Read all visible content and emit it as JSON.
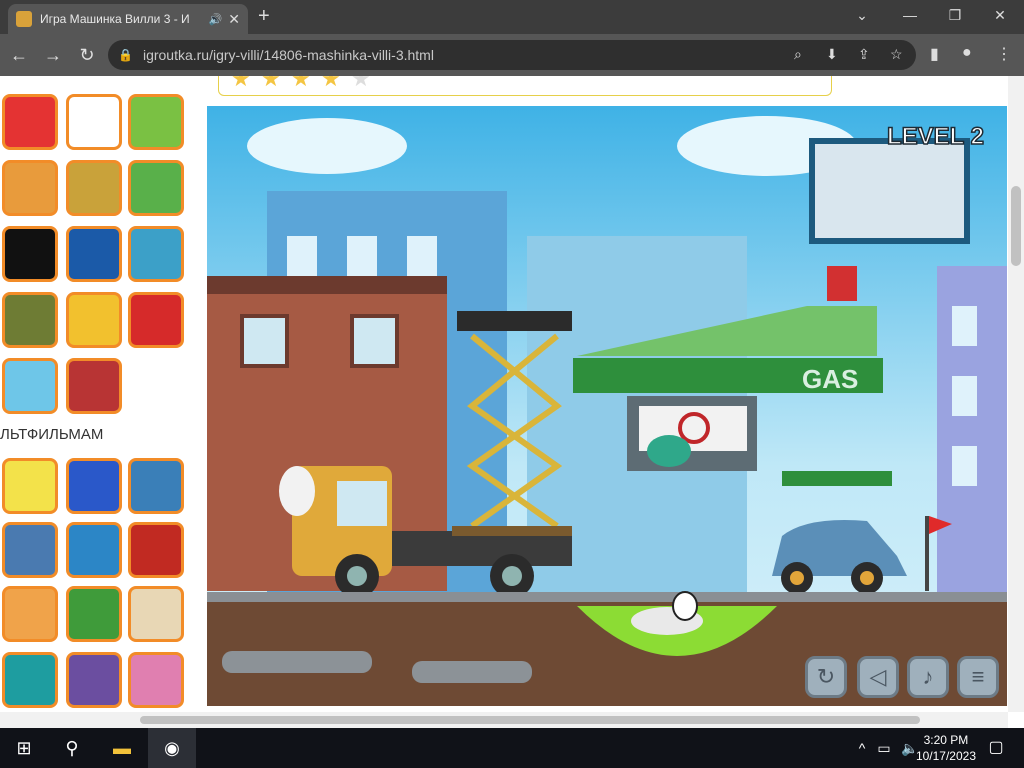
{
  "browser": {
    "tab_title": "Игра Машинка Вилли 3 - И",
    "new_tab": "+",
    "url": "igroutka.ru/igry-villi/14806-mashinka-villi-3.html"
  },
  "sidebar": {
    "section_title": "ЛЬТФИЛЬМАМ"
  },
  "game": {
    "level_label": "LEVEL 2",
    "sign_gas": "GAS"
  },
  "taskbar": {
    "time": "3:20 PM",
    "date": "10/17/2023"
  },
  "colors": {
    "tab_bg": "#565656",
    "accent_orange": "#f28c28",
    "sky": "#3fb2e6"
  }
}
